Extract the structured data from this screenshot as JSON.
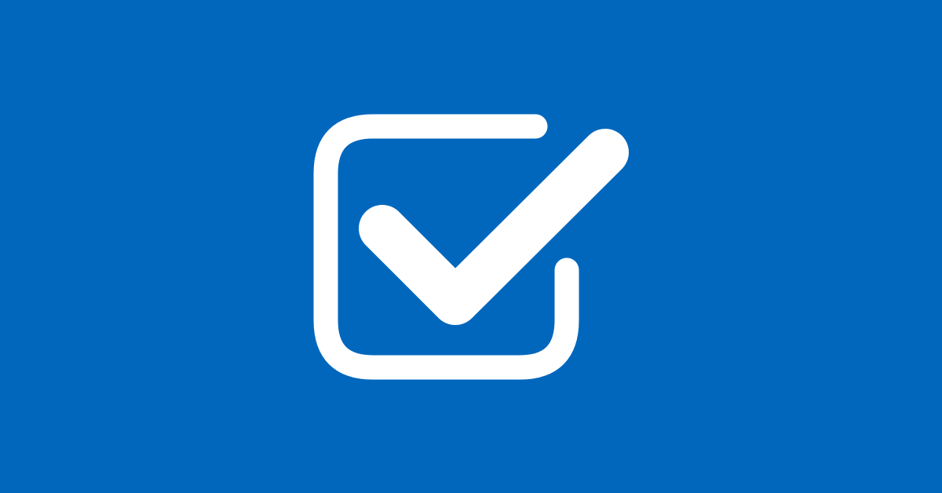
{
  "background": {
    "color": "#0067BD"
  },
  "icon": {
    "name": "checked-checkbox-icon",
    "color": "#FFFFFF"
  }
}
